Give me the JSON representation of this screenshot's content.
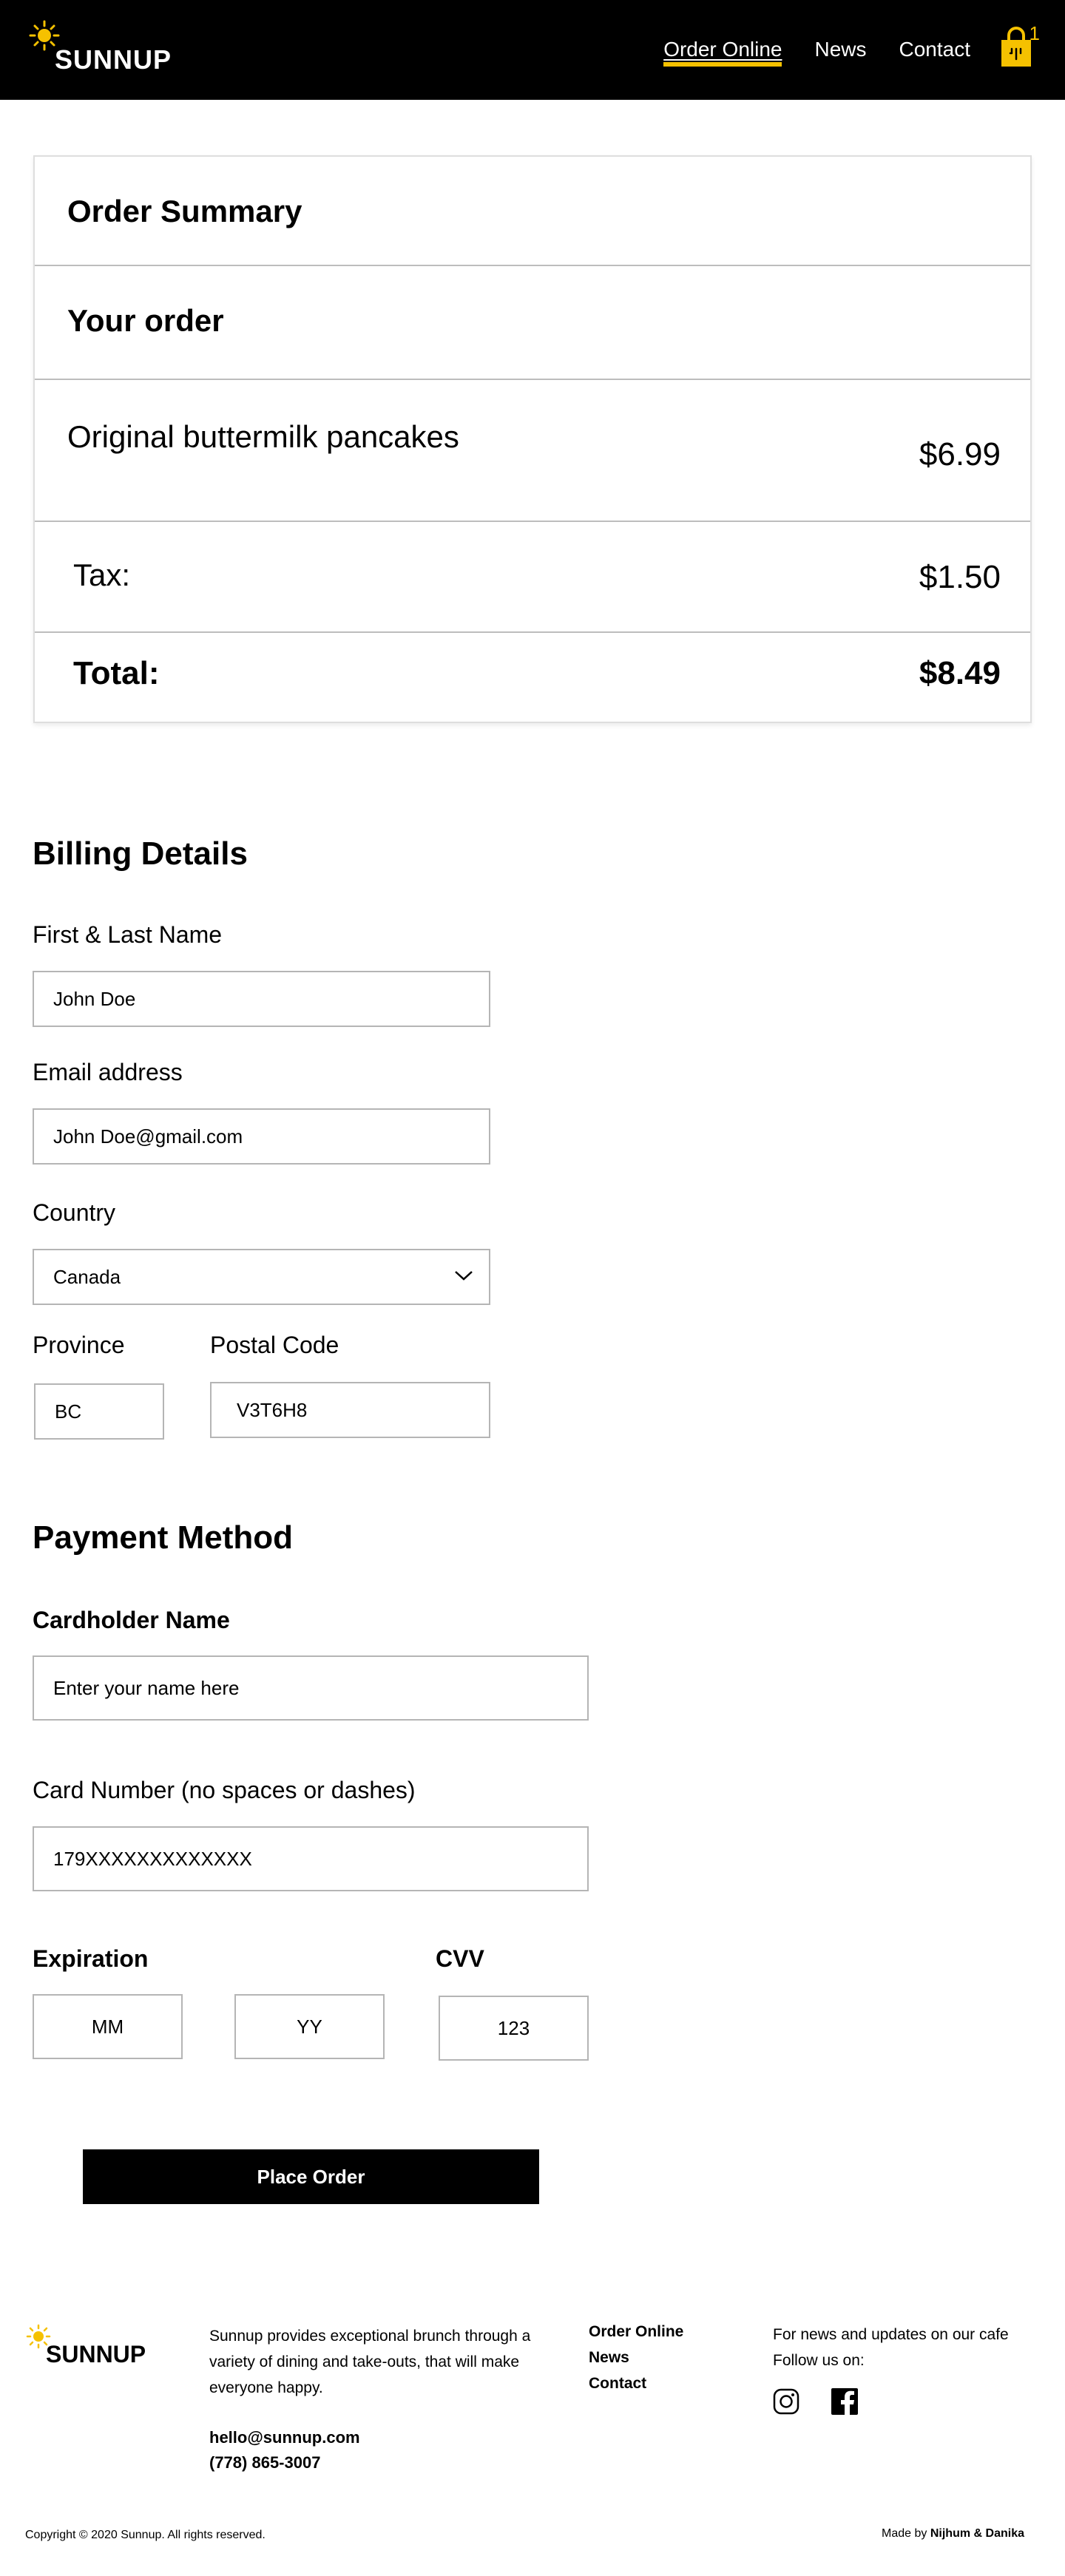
{
  "header": {
    "brand": "SUNNUP",
    "nav": [
      {
        "label": "Order Online",
        "active": true
      },
      {
        "label": "News",
        "active": false
      },
      {
        "label": "Contact",
        "active": false
      }
    ],
    "cart_count": "1",
    "accent_color": "#f5c100"
  },
  "summary": {
    "title": "Order Summary",
    "your_order": "Your order",
    "item_name": "Original buttermilk pancakes",
    "item_price": "$6.99",
    "tax_label": "Tax:",
    "tax_value": "$1.50",
    "total_label": "Total:",
    "total_value": "$8.49"
  },
  "billing": {
    "title": "Billing Details",
    "name_label": "First & Last Name",
    "name_value": "John Doe",
    "email_label": "Email address",
    "email_value": "John Doe@gmail.com",
    "country_label": "Country",
    "country_value": "Canada",
    "province_label": "Province",
    "province_value": "BC",
    "postal_label": "Postal Code",
    "postal_value": "V3T6H8"
  },
  "payment": {
    "title": "Payment Method",
    "cardholder_label": "Cardholder Name",
    "cardholder_placeholder": "Enter your name here",
    "card_label": "Card Number (no spaces or dashes)",
    "card_value": "179XXXXXXXXXXXXX",
    "expiration_label": "Expiration",
    "mm_placeholder": "MM",
    "yy_placeholder": "YY",
    "cvv_label": "CVV",
    "cvv_placeholder": "123",
    "place_order": "Place Order"
  },
  "footer": {
    "brand": "SUNNUP",
    "description": "Sunnup provides exceptional brunch through a variety of dining and take-outs, that will make everyone happy.",
    "email": "hello@sunnup.com",
    "phone": "(778) 865-3007",
    "links": [
      "Order Online",
      "News",
      "Contact"
    ],
    "news_text": "For news and updates on our cafe",
    "follow_text": "Follow us on:",
    "copyright": "Copyright © 2020 Sunnup. All rights reserved.",
    "made_by_prefix": "Made by",
    "made_by_names": "Nijhum & Danika"
  }
}
